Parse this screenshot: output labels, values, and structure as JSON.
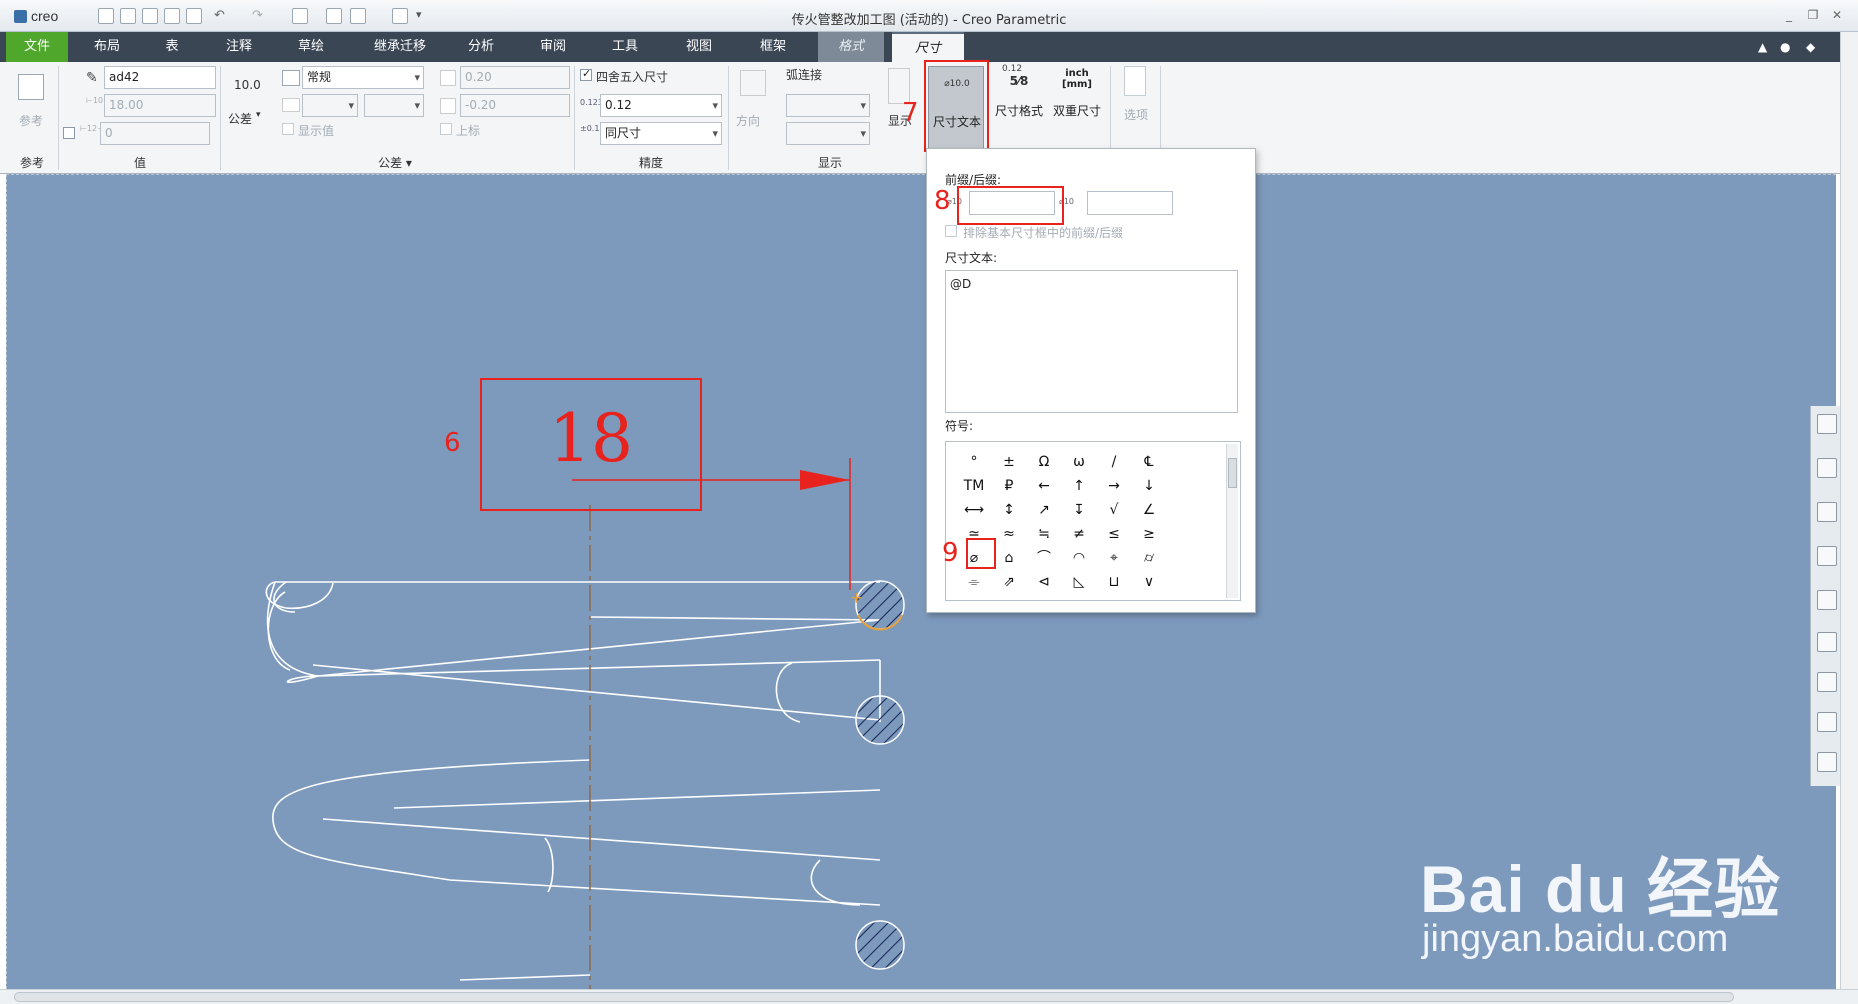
{
  "app": {
    "logo": "creo",
    "window_title": "传火管整改加工图 (活动的) - Creo Parametric"
  },
  "tabs": [
    {
      "label": "文件"
    },
    {
      "label": "布局"
    },
    {
      "label": "表"
    },
    {
      "label": "注释"
    },
    {
      "label": "草绘"
    },
    {
      "label": "继承迁移"
    },
    {
      "label": "分析"
    },
    {
      "label": "审阅"
    },
    {
      "label": "工具"
    },
    {
      "label": "视图"
    },
    {
      "label": "框架"
    },
    {
      "label": "格式"
    },
    {
      "label": "尺寸"
    }
  ],
  "ribbon": {
    "reference": {
      "label": "参考",
      "group": "参考"
    },
    "value": {
      "name_field": "ad42",
      "value_field": "18.00",
      "override_field": "0",
      "group": "值"
    },
    "tolerance": {
      "decimal_icon": "10.0",
      "tolerance_btn": "公差",
      "mode_select": "常规",
      "upper": "0.20",
      "lower": "-0.20",
      "show_value": "显示值",
      "superscript": "上标",
      "group": "公差"
    },
    "precision": {
      "round_label": "四舍五入尺寸",
      "decimal_select": "0.12",
      "same_select": "同尺寸",
      "group": "精度"
    },
    "display": {
      "direction": "方向",
      "arc_join": "弧连接",
      "show": "显示",
      "group": "显示"
    },
    "dim_text_btn": "尺寸文本",
    "dim_text_icon": "⌀10.0",
    "dim_format": "尺寸格式",
    "dim_format_top": "0.12",
    "dim_format_frac": "5⁄8",
    "dual_dim": "双重尺寸",
    "dual_top": "inch",
    "dual_bottom": "[mm]",
    "options": "选项"
  },
  "popup": {
    "prefix_suffix_label": "前缀/后缀:",
    "prefix_value": "",
    "suffix_value": "",
    "exclude_label": "排除基本尺寸框中的前缀/后缀",
    "dim_text_label": "尺寸文本:",
    "dim_text_value": "@D",
    "symbols_label": "符号:",
    "symbols": [
      [
        "°",
        "±",
        "Ω",
        "ω",
        "/",
        "℄"
      ],
      [
        "TM",
        "₽",
        "←",
        "↑",
        "→",
        "↓"
      ],
      [
        "⟷",
        "↕",
        "↗",
        "↧",
        "√",
        "∠"
      ],
      [
        "≃",
        "≈",
        "≒",
        "≠",
        "≤",
        "≥"
      ],
      [
        "⌀",
        "⌂",
        "⌒",
        "◠",
        "⌖",
        "⌭"
      ],
      [
        "⌯",
        "⇗",
        "⊲",
        "◺",
        "⊔",
        "∨"
      ]
    ]
  },
  "drawing": {
    "dimension_value": "18"
  },
  "annotations": {
    "step6": "6",
    "step7": "7",
    "step8": "8",
    "step9": "9"
  },
  "watermark": {
    "brand": "Bai du 经验",
    "url": "jingyan.baidu.com"
  },
  "colors": {
    "canvas": "#7d9abd",
    "file_tab": "#4fa82c",
    "highlight_red": "#e8221c"
  }
}
